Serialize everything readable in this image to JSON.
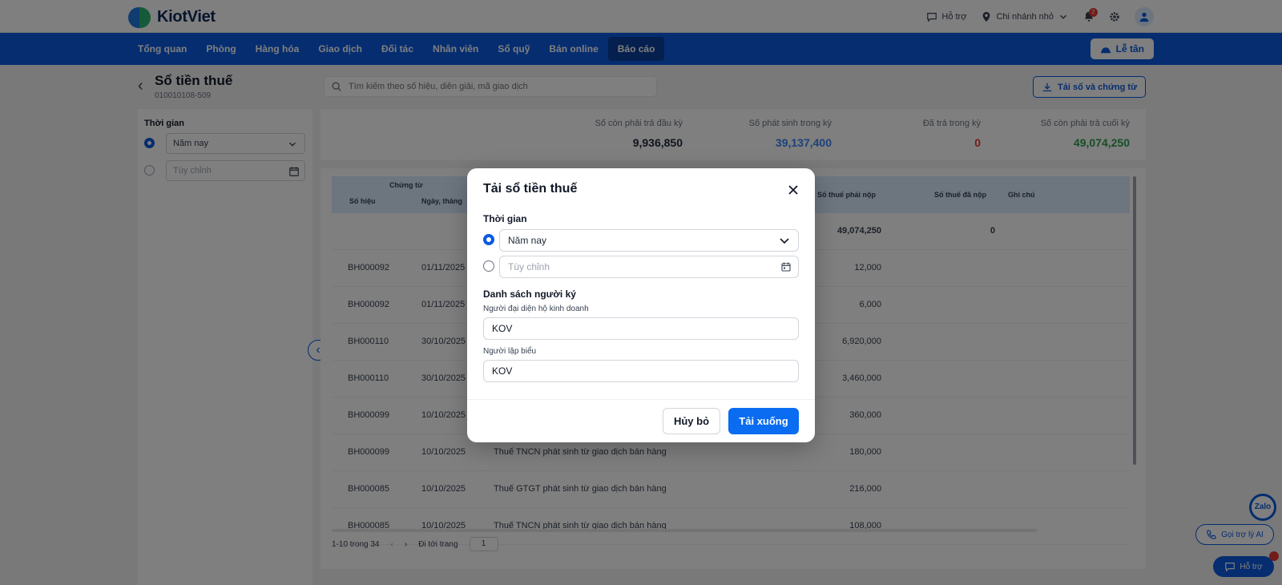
{
  "app": {
    "name": "KiotViet"
  },
  "header": {
    "support_label": "Hỗ trợ",
    "branch_label": "Chi nhánh nhỏ",
    "notification_count": "2"
  },
  "nav": {
    "items": [
      "Tổng quan",
      "Phòng",
      "Hàng hóa",
      "Giao dịch",
      "Đối tác",
      "Nhân viên",
      "Sổ quỹ",
      "Bán online",
      "Báo cáo"
    ],
    "active_index": 8,
    "reception_label": "Lễ tân"
  },
  "page": {
    "title": "Sổ tiền thuế",
    "subtitle": "010010108-509",
    "search_placeholder": "Tìm kiếm theo số hiệu, diễn giải, mã giao dịch",
    "download_voucher_label": "Tải sổ và chứng từ"
  },
  "sidebar": {
    "time_label": "Thời gian",
    "preset_value": "Năm nay",
    "custom_placeholder": "Tùy chỉnh"
  },
  "summary": {
    "opening_label": "Số còn phải trả đầu kỳ",
    "opening_value": "9,936,850",
    "arising_label": "Số phát sinh trong kỳ",
    "arising_value": "39,137,400",
    "paid_label": "Đã trả trong kỳ",
    "paid_value": "0",
    "closing_label": "Số còn phải trả cuối kỳ",
    "closing_value": "49,074,250",
    "colors": {
      "arising": "#3b82f6",
      "paid": "#e53935",
      "closing": "#2e9e4f"
    }
  },
  "table": {
    "group_header": "Chứng từ",
    "columns": [
      "Số hiệu",
      "Ngày, tháng",
      "Số thuế phải nộp",
      "Số thuế đã nộp",
      "Ghi chú"
    ],
    "total_row": {
      "payable": "49,074,250",
      "paid": "0"
    },
    "rows": [
      {
        "code": "BH000092",
        "date": "01/11/2025",
        "desc": "",
        "amount": "12,000"
      },
      {
        "code": "BH000092",
        "date": "01/11/2025",
        "desc": "",
        "amount": "6,000"
      },
      {
        "code": "BH000110",
        "date": "30/10/2025",
        "desc": "",
        "amount": "6,920,000"
      },
      {
        "code": "BH000110",
        "date": "30/10/2025",
        "desc": "",
        "amount": "3,460,000"
      },
      {
        "code": "BH000099",
        "date": "10/10/2025",
        "desc": "",
        "amount": "360,000"
      },
      {
        "code": "BH000099",
        "date": "10/10/2025",
        "desc": "Thuế TNCN phát sinh từ giao dịch bán hàng",
        "amount": "180,000"
      },
      {
        "code": "BH000085",
        "date": "10/10/2025",
        "desc": "Thuế GTGT phát sinh từ giao dịch bán hàng",
        "amount": "216,000"
      },
      {
        "code": "BH000085",
        "date": "10/10/2025",
        "desc": "Thuế TNCN phát sinh từ giao dịch bán hàng",
        "amount": "108,000"
      }
    ],
    "pager_text": "1-10 trong 34",
    "goto_label": "Đi tới trang",
    "goto_value": "1"
  },
  "floating": {
    "zalo_label": "Zalo",
    "ai_label": "Gọi trợ lý AI",
    "help_label": "Hỗ trợ"
  },
  "modal": {
    "title": "Tải sổ tiền thuế",
    "time_section": "Thời gian",
    "preset_value": "Năm nay",
    "custom_placeholder": "Tùy chỉnh",
    "signers_section": "Danh sách người ký",
    "representative_label": "Người đại diện hộ kinh doanh",
    "representative_value": "KOV",
    "preparer_label": "Người lập biểu",
    "preparer_value": "KOV",
    "cancel_label": "Hủy bỏ",
    "download_label": "Tải xuống"
  }
}
